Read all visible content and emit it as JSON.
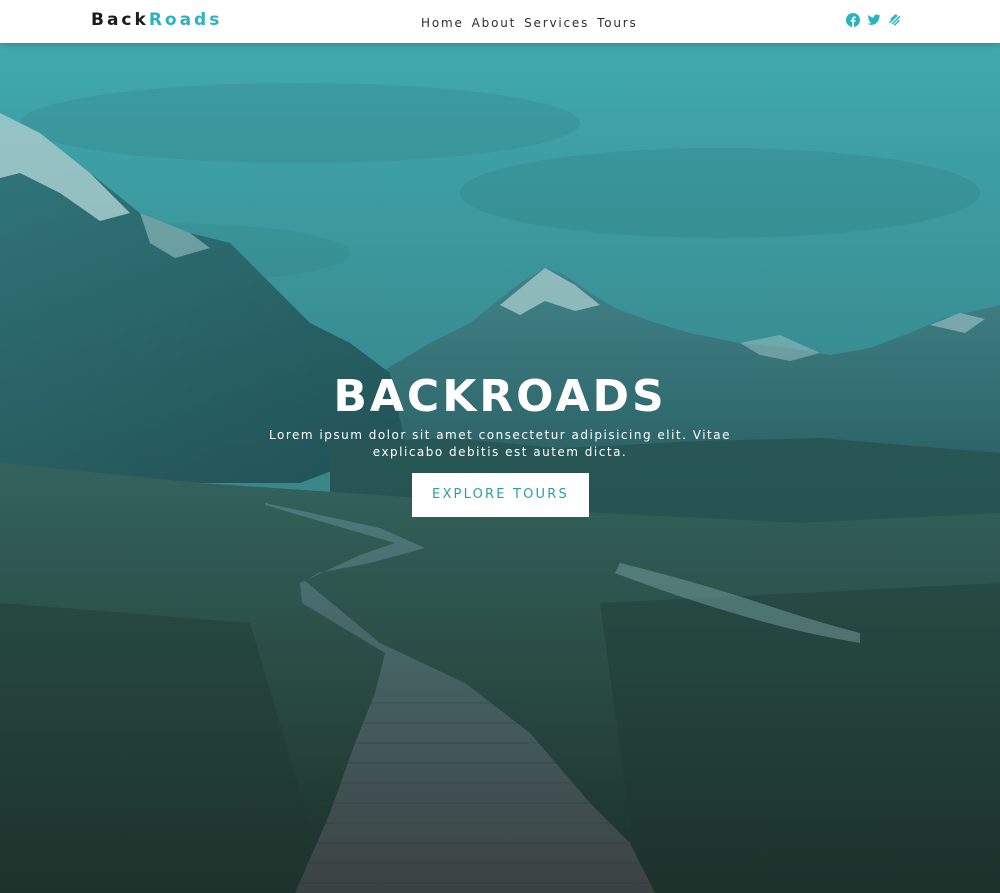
{
  "brand": {
    "part1": "Back",
    "part2": "Roads"
  },
  "nav": {
    "links": [
      {
        "label": "Home"
      },
      {
        "label": "About"
      },
      {
        "label": "Services"
      },
      {
        "label": "Tours"
      }
    ],
    "social": [
      {
        "icon": "facebook-icon"
      },
      {
        "icon": "twitter-icon"
      },
      {
        "icon": "squarespace-icon"
      }
    ]
  },
  "hero": {
    "title": "BACKROADS",
    "text": "Lorem ipsum dolor sit amet consectetur adipisicing elit. Vitae explicabo debitis est autem dicta.",
    "button_label": "EXPLORE TOURS"
  },
  "colors": {
    "accent": "#2ab3bf",
    "nav_background": "#ffffff",
    "hero_overlay": "#2aaab0",
    "button_text": "#2a9fa8"
  }
}
